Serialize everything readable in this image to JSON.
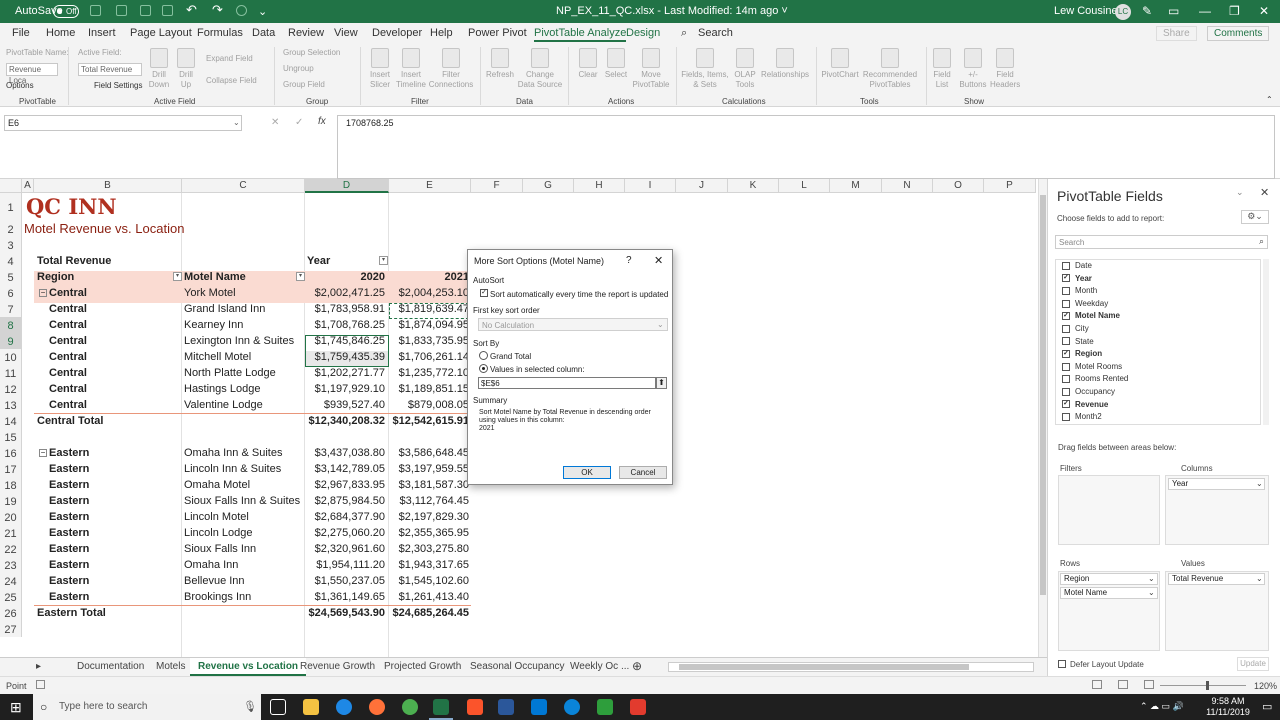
{
  "titlebar": {
    "autosave_label": "AutoSave",
    "autosave_state": "Off",
    "doc_title": "NP_EX_11_QC.xlsx  -  Last Modified: 14m ago  ˅",
    "user_name": "Lew Cousineau",
    "user_initials": "LC"
  },
  "tabs": [
    "File",
    "Home",
    "Insert",
    "Page Layout",
    "Formulas",
    "Data",
    "Review",
    "View",
    "Developer",
    "Help",
    "Power Pivot",
    "PivotTable Analyze",
    "Design"
  ],
  "tell_me": "Search",
  "share_label": "Share",
  "comments_label": "Comments",
  "ribbon": {
    "pivot_name_label": "PivotTable Name:",
    "pivot_name_value": "Revenue Loca",
    "options_label": "Options",
    "active_field_label": "Active Field:",
    "active_field_value": "Total Revenue",
    "field_settings_label": "Field Settings",
    "drill_down": "Drill Down",
    "drill_up": "Drill Up",
    "expand_field": "Expand Field",
    "collapse_field": "Collapse Field",
    "group_selection": "Group Selection",
    "ungroup": "Ungroup",
    "group_field": "Group Field",
    "insert_slicer": "Insert Slicer",
    "insert_timeline": "Insert Timeline",
    "filter_connections": "Filter Connections",
    "refresh": "Refresh",
    "change_data_source": "Change Data Source",
    "clear": "Clear",
    "select": "Select",
    "move_pivottable": "Move PivotTable",
    "fields_items_sets": "Fields, Items, & Sets",
    "olap_tools": "OLAP Tools",
    "relationships": "Relationships",
    "pivotchart": "PivotChart",
    "recommended_pivottables": "Recommended PivotTables",
    "field_list": "Field List",
    "buttons": "+/- Buttons",
    "field_headers": "Field Headers",
    "groups": [
      "PivotTable",
      "Active Field",
      "Group",
      "Filter",
      "Data",
      "Actions",
      "Calculations",
      "Tools",
      "Show"
    ]
  },
  "formula_bar": {
    "name_box": "E6",
    "fx": "fx",
    "formula": "1708768.25"
  },
  "columns": [
    "A",
    "B",
    "C",
    "D",
    "E",
    "F",
    "G",
    "H",
    "I",
    "J",
    "K",
    "L",
    "M",
    "N",
    "O",
    "P"
  ],
  "rows": [
    "1",
    "2",
    "3",
    "4",
    "5",
    "6",
    "7",
    "8",
    "9",
    "10",
    "11",
    "12",
    "13",
    "14",
    "15",
    "16",
    "17",
    "18",
    "19",
    "20",
    "21",
    "22",
    "23",
    "24",
    "25",
    "26",
    "27"
  ],
  "sheet": {
    "title": "QC INN",
    "subtitle": "Motel Revenue vs. Location",
    "hdr_total_revenue": "Total Revenue",
    "hdr_year": "Year",
    "hdr_region": "Region",
    "hdr_motel_name": "Motel Name",
    "hdr_2020": "2020",
    "hdr_2021": "2021",
    "central": [
      {
        "region": "Central",
        "motel": "York Motel",
        "y2020": "$2,002,471.25",
        "y2021": "$2,004,253.10"
      },
      {
        "region": "Central",
        "motel": "Grand Island Inn",
        "y2020": "$1,783,958.91",
        "y2021": "$1,819,639.47"
      },
      {
        "region": "Central",
        "motel": "Kearney Inn",
        "y2020": "$1,708,768.25",
        "y2021": "$1,874,094.95"
      },
      {
        "region": "Central",
        "motel": "Lexington Inn & Suites",
        "y2020": "$1,745,846.25",
        "y2021": "$1,833,735.95"
      },
      {
        "region": "Central",
        "motel": "Mitchell Motel",
        "y2020": "$1,759,435.39",
        "y2021": "$1,706,261.14"
      },
      {
        "region": "Central",
        "motel": "North Platte Lodge",
        "y2020": "$1,202,271.77",
        "y2021": "$1,235,772.10"
      },
      {
        "region": "Central",
        "motel": "Hastings Lodge",
        "y2020": "$1,197,929.10",
        "y2021": "$1,189,851.15"
      },
      {
        "region": "Central",
        "motel": "Valentine Lodge",
        "y2020": "$939,527.40",
        "y2021": "$879,008.05"
      }
    ],
    "central_total": {
      "label": "Central Total",
      "y2020": "$12,340,208.32",
      "y2021": "$12,542,615.91"
    },
    "eastern": [
      {
        "region": "Eastern",
        "motel": "Omaha Inn & Suites",
        "y2020": "$3,437,038.80",
        "y2021": "$3,586,648.45"
      },
      {
        "region": "Eastern",
        "motel": "Lincoln Inn & Suites",
        "y2020": "$3,142,789.05",
        "y2021": "$3,197,959.55"
      },
      {
        "region": "Eastern",
        "motel": "Omaha Motel",
        "y2020": "$2,967,833.95",
        "y2021": "$3,181,587.30"
      },
      {
        "region": "Eastern",
        "motel": "Sioux Falls Inn & Suites",
        "y2020": "$2,875,984.50",
        "y2021": "$3,112,764.45"
      },
      {
        "region": "Eastern",
        "motel": "Lincoln Motel",
        "y2020": "$2,684,377.90",
        "y2021": "$2,197,829.30"
      },
      {
        "region": "Eastern",
        "motel": "Lincoln Lodge",
        "y2020": "$2,275,060.20",
        "y2021": "$2,355,365.95"
      },
      {
        "region": "Eastern",
        "motel": "Sioux Falls Inn",
        "y2020": "$2,320,961.60",
        "y2021": "$2,303,275.80"
      },
      {
        "region": "Eastern",
        "motel": "Omaha Inn",
        "y2020": "$1,954,111.20",
        "y2021": "$1,943,317.65"
      },
      {
        "region": "Eastern",
        "motel": "Bellevue Inn",
        "y2020": "$1,550,237.05",
        "y2021": "$1,545,102.60"
      },
      {
        "region": "Eastern",
        "motel": "Brookings Inn",
        "y2020": "$1,361,149.65",
        "y2021": "$1,261,413.40"
      }
    ],
    "eastern_total": {
      "label": "Eastern Total",
      "y2020": "$24,569,543.90",
      "y2021": "$24,685,264.45"
    }
  },
  "dialog": {
    "title": "More Sort Options (Motel Name)",
    "help": "?",
    "autosort_label": "AutoSort",
    "autosort_check": "Sort automatically every time the report is updated",
    "first_key_label": "First key sort order",
    "first_key_value": "No Calculation",
    "sort_by_label": "Sort By",
    "grand_total": "Grand Total",
    "values_in_col": "Values in selected column:",
    "ref_value": "$E$6",
    "summary_label": "Summary",
    "summary_line1": "Sort Motel Name by Total Revenue in descending order",
    "summary_line2": "using values in this column:",
    "summary_line3": "2021",
    "ok": "OK",
    "cancel": "Cancel"
  },
  "pane": {
    "title": "PivotTable Fields",
    "choose": "Choose fields to add to report:",
    "search_placeholder": "Search",
    "fields": [
      {
        "name": "Date",
        "checked": false
      },
      {
        "name": "Year",
        "checked": true
      },
      {
        "name": "Month",
        "checked": false
      },
      {
        "name": "Weekday",
        "checked": false
      },
      {
        "name": "Motel Name",
        "checked": true
      },
      {
        "name": "City",
        "checked": false
      },
      {
        "name": "State",
        "checked": false
      },
      {
        "name": "Region",
        "checked": true
      },
      {
        "name": "Motel Rooms",
        "checked": false
      },
      {
        "name": "Rooms Rented",
        "checked": false
      },
      {
        "name": "Occupancy",
        "checked": false
      },
      {
        "name": "Revenue",
        "checked": true
      },
      {
        "name": "Month2",
        "checked": false
      }
    ],
    "drag_label": "Drag fields between areas below:",
    "filters": "Filters",
    "columns_label": "Columns",
    "rows_label": "Rows",
    "values_label": "Values",
    "columns_items": [
      "Year"
    ],
    "rows_items": [
      "Region",
      "Motel Name"
    ],
    "values_items": [
      "Total Revenue"
    ],
    "defer": "Defer Layout Update",
    "update": "Update"
  },
  "sheet_tabs": [
    "Documentation",
    "Motels",
    "Revenue vs Location",
    "Revenue Growth",
    "Projected Growth",
    "Seasonal Occupancy",
    "Weekly Oc ..."
  ],
  "status": {
    "mode": "Point",
    "zoom": "120%"
  },
  "taskbar": {
    "search_placeholder": "Type here to search",
    "time": "9:58 AM",
    "date": "11/11/2019"
  },
  "colors": {
    "excel_green": "#217346",
    "header_band": "#fadbd2",
    "title_red": "#b03020"
  }
}
